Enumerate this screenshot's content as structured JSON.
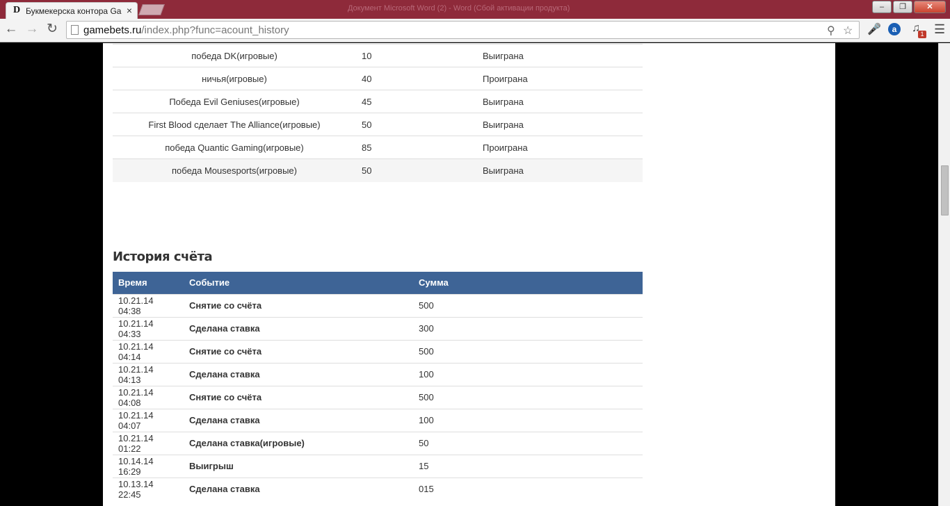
{
  "browser": {
    "tab_title": "Букмекерска контора Ga",
    "tab_favicon": "D",
    "tab_close": "×",
    "background_window_title": "Документ Microsoft Word (2) - Word (Сбой активации продукта)",
    "url_host": "gamebets.ru",
    "url_path": "/index.php?func=acount_history",
    "badge_count": "1",
    "abp_label": "a"
  },
  "bets": [
    {
      "event": "победа DK(игровые)",
      "amount": "10",
      "result": "Выиграна"
    },
    {
      "event": "ничья(игровые)",
      "amount": "40",
      "result": "Проиграна"
    },
    {
      "event": "Победа Evil Geniuses(игровые)",
      "amount": "45",
      "result": "Выиграна"
    },
    {
      "event": "First Blood сделает The Alliance(игровые)",
      "amount": "50",
      "result": "Выиграна"
    },
    {
      "event": "победа Quantic Gaming(игровые)",
      "amount": "85",
      "result": "Проиграна"
    },
    {
      "event": "победа Mousesports(игровые)",
      "amount": "50",
      "result": "Выиграна"
    }
  ],
  "history": {
    "title": "История счёта",
    "headers": {
      "time": "Время",
      "event": "Событие",
      "amount": "Сумма"
    },
    "rows": [
      {
        "time": "10.21.14 04:38",
        "event": "Снятие со счёта",
        "amount": "500"
      },
      {
        "time": "10.21.14 04:33",
        "event": "Сделана ставка",
        "amount": "300"
      },
      {
        "time": "10.21.14 04:14",
        "event": "Снятие со счёта",
        "amount": "500"
      },
      {
        "time": "10.21.14 04:13",
        "event": "Сделана ставка",
        "amount": "100"
      },
      {
        "time": "10.21.14 04:08",
        "event": "Снятие со счёта",
        "amount": "500"
      },
      {
        "time": "10.21.14 04:07",
        "event": "Сделана ставка",
        "amount": "100"
      },
      {
        "time": "10.21.14 01:22",
        "event": "Сделана ставка(игровые)",
        "amount": "50"
      },
      {
        "time": "10.14.14 16:29",
        "event": "Выигрыш",
        "amount": "15"
      },
      {
        "time": "10.13.14 22:45",
        "event": "Сделана ставка",
        "amount": "015"
      }
    ]
  },
  "colors": {
    "titlebar": "#8e2a3a",
    "table_header": "#3e6496",
    "page_background": "#ffffff",
    "side_background": "#000000"
  }
}
